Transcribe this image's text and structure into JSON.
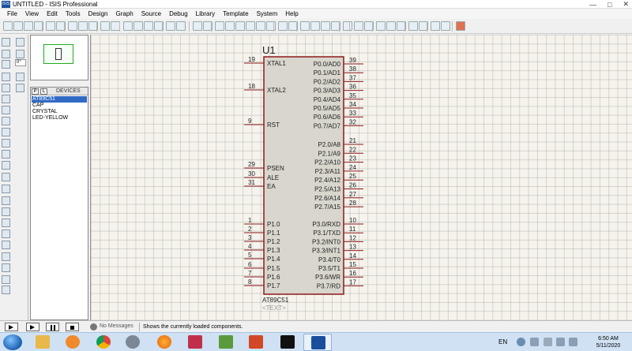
{
  "window": {
    "app_icon_label": "ISIS",
    "title": "UNTITLED - ISIS Professional"
  },
  "menu": [
    "File",
    "View",
    "Edit",
    "Tools",
    "Design",
    "Graph",
    "Source",
    "Debug",
    "Library",
    "Template",
    "System",
    "Help"
  ],
  "rotation_value": "0°",
  "device_panel": {
    "p_button": "P",
    "l_button": "L",
    "label": "DEVICES",
    "items": [
      "AT89C51",
      "CAP",
      "CRYSTAL",
      "LED-YELLOW"
    ],
    "selected": 0
  },
  "component": {
    "ref": "U1",
    "part": "AT89C51",
    "text_placeholder": "<TEXT>",
    "left_pins": [
      {
        "num": "19",
        "name": "XTAL1"
      },
      {
        "num": "18",
        "name": "XTAL2"
      },
      {
        "num": "9",
        "name": "RST"
      },
      {
        "num": "29",
        "name": "PSEN"
      },
      {
        "num": "30",
        "name": "ALE"
      },
      {
        "num": "31",
        "name": "EA"
      },
      {
        "num": "1",
        "name": "P1.0"
      },
      {
        "num": "2",
        "name": "P1.1"
      },
      {
        "num": "3",
        "name": "P1.2"
      },
      {
        "num": "4",
        "name": "P1.3"
      },
      {
        "num": "5",
        "name": "P1.4"
      },
      {
        "num": "6",
        "name": "P1.5"
      },
      {
        "num": "7",
        "name": "P1.6"
      },
      {
        "num": "8",
        "name": "P1.7"
      }
    ],
    "right_pins": [
      {
        "num": "39",
        "name": "P0.0/AD0"
      },
      {
        "num": "38",
        "name": "P0.1/AD1"
      },
      {
        "num": "37",
        "name": "P0.2/AD2"
      },
      {
        "num": "36",
        "name": "P0.3/AD3"
      },
      {
        "num": "35",
        "name": "P0.4/AD4"
      },
      {
        "num": "34",
        "name": "P0.5/AD5"
      },
      {
        "num": "33",
        "name": "P0.6/AD6"
      },
      {
        "num": "32",
        "name": "P0.7/AD7"
      },
      {
        "num": "21",
        "name": "P2.0/A8"
      },
      {
        "num": "22",
        "name": "P2.1/A9"
      },
      {
        "num": "23",
        "name": "P2.2/A10"
      },
      {
        "num": "24",
        "name": "P2.3/A11"
      },
      {
        "num": "25",
        "name": "P2.4/A12"
      },
      {
        "num": "26",
        "name": "P2.5/A13"
      },
      {
        "num": "27",
        "name": "P2.6/A14"
      },
      {
        "num": "28",
        "name": "P2.7/A15"
      },
      {
        "num": "10",
        "name": "P3.0/RXD"
      },
      {
        "num": "11",
        "name": "P3.1/TXD"
      },
      {
        "num": "12",
        "name": "P3.2/INT0"
      },
      {
        "num": "13",
        "name": "P3.3/INT1"
      },
      {
        "num": "14",
        "name": "P3.4/T0"
      },
      {
        "num": "15",
        "name": "P3.5/T1"
      },
      {
        "num": "16",
        "name": "P3.6/WR"
      },
      {
        "num": "17",
        "name": "P3.7/RD"
      }
    ]
  },
  "status": {
    "messages": "No Messages",
    "hint": "Shows the currently loaded components."
  },
  "taskbar": {
    "language": "EN",
    "time": "6:50 AM",
    "date": "5/11/2020"
  },
  "colors": {
    "grid_bg": "#f5f3ec",
    "chip_fill": "#d8d6cd",
    "chip_border": "#8b1a1a",
    "pin_line": "#8b1a1a",
    "selection": "#316ac5"
  }
}
